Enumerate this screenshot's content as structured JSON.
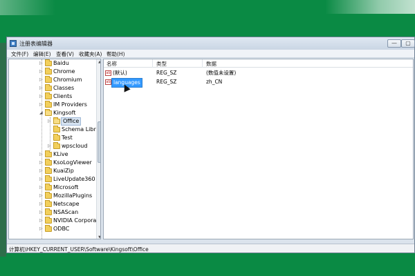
{
  "window": {
    "title": "注册表编辑器",
    "minimize_glyph": "—",
    "maximize_glyph": "▢"
  },
  "menu": {
    "items": [
      "文件(F)",
      "编辑(E)",
      "查看(V)",
      "收藏夹(A)",
      "帮助(H)"
    ]
  },
  "tree": {
    "items": [
      {
        "label": "Baidu"
      },
      {
        "label": "Chrome"
      },
      {
        "label": "Chromium"
      },
      {
        "label": "Classes"
      },
      {
        "label": "Clients"
      },
      {
        "label": "IM Providers"
      },
      {
        "label": "Kingsoft"
      },
      {
        "label": "Office"
      },
      {
        "label": "Schema Libra"
      },
      {
        "label": "Test"
      },
      {
        "label": "wpscloud"
      },
      {
        "label": "KLive"
      },
      {
        "label": "KsoLogViewer"
      },
      {
        "label": "KuaiZip"
      },
      {
        "label": "LiveUpdate360"
      },
      {
        "label": "Microsoft"
      },
      {
        "label": "MozillaPlugins"
      },
      {
        "label": "Netscape"
      },
      {
        "label": "NSAScan"
      },
      {
        "label": "NVIDIA Corpora"
      },
      {
        "label": "ODBC"
      }
    ]
  },
  "list": {
    "headers": {
      "name": "名称",
      "type": "类型",
      "data": "数据"
    },
    "rows": [
      {
        "icon": "ab",
        "name": "(默认)",
        "type": "REG_SZ",
        "data": "(数值未设置)"
      },
      {
        "icon": "ab",
        "name": "languages",
        "type": "REG_SZ",
        "data": "zh_CN"
      }
    ]
  },
  "statusbar": {
    "path": "计算机\\HKEY_CURRENT_USER\\Software\\Kingsoft\\Office"
  },
  "icons": {
    "app": "registry-editor-icon",
    "folder": "folder-icon",
    "value": "string-value-icon",
    "cursor": "mouse-cursor-icon"
  },
  "colors": {
    "background": "#0a8a44",
    "selection": "#3399ff"
  }
}
